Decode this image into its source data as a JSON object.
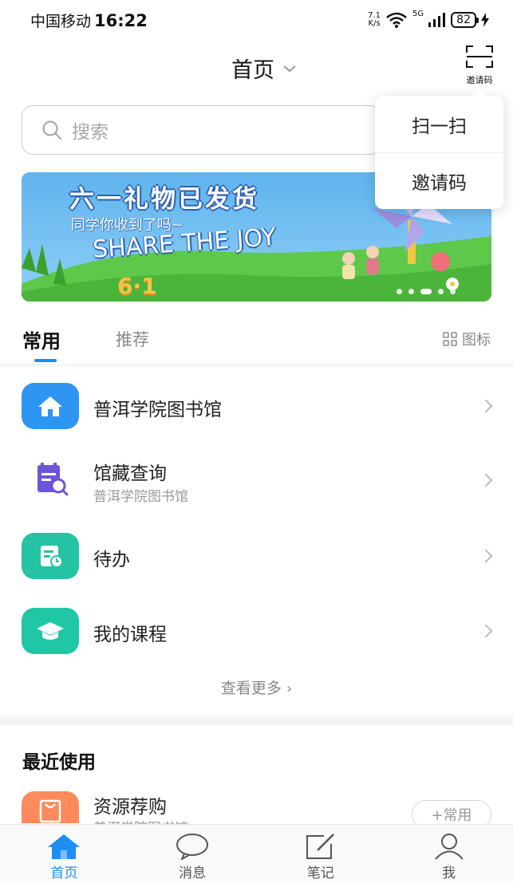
{
  "status_bar": {
    "carrier": "中国移动",
    "time": "16:22",
    "speed_value": "7.1",
    "speed_unit": "K/s",
    "network": "5G",
    "battery": "82"
  },
  "header": {
    "title": "首页",
    "scan_label": "邀请码"
  },
  "search": {
    "placeholder": "搜索"
  },
  "popup_menu": {
    "items": [
      {
        "label": "扫一扫"
      },
      {
        "label": "邀请码"
      }
    ]
  },
  "banner": {
    "title": "六一礼物已发货",
    "subtitle": "同学你收到了吗~",
    "english": "SHARE THE JOY",
    "badge": "6·1",
    "dot_count": 5,
    "active_dot": 3
  },
  "tabs": {
    "common": "常用",
    "recommend": "推荐",
    "icon_view": "图标"
  },
  "list": {
    "items": [
      {
        "title": "普洱学院图书馆",
        "subtitle": "",
        "icon": "home-icon",
        "color": "#2e95f2"
      },
      {
        "title": "馆藏查询",
        "subtitle": "普洱学院图书馆",
        "icon": "catalog-search-icon",
        "color": "#6c55d8"
      },
      {
        "title": "待办",
        "subtitle": "",
        "icon": "todo-icon",
        "color": "#25c2a3"
      },
      {
        "title": "我的课程",
        "subtitle": "",
        "icon": "graduation-cap-icon",
        "color": "#1fc7a4"
      }
    ],
    "see_more": "查看更多"
  },
  "recent": {
    "title": "最近使用",
    "item_title": "资源荐购",
    "item_subtitle": "普洱学院图书馆",
    "add_button": "+常用",
    "item_color": "#ff8a5b"
  },
  "tabbar": {
    "items": [
      {
        "label": "首页",
        "icon": "home-icon",
        "active": true
      },
      {
        "label": "消息",
        "icon": "message-icon",
        "active": false
      },
      {
        "label": "笔记",
        "icon": "note-icon",
        "active": false
      },
      {
        "label": "我",
        "icon": "user-icon",
        "active": false
      }
    ]
  },
  "colors": {
    "accent": "#1e8ef5"
  }
}
